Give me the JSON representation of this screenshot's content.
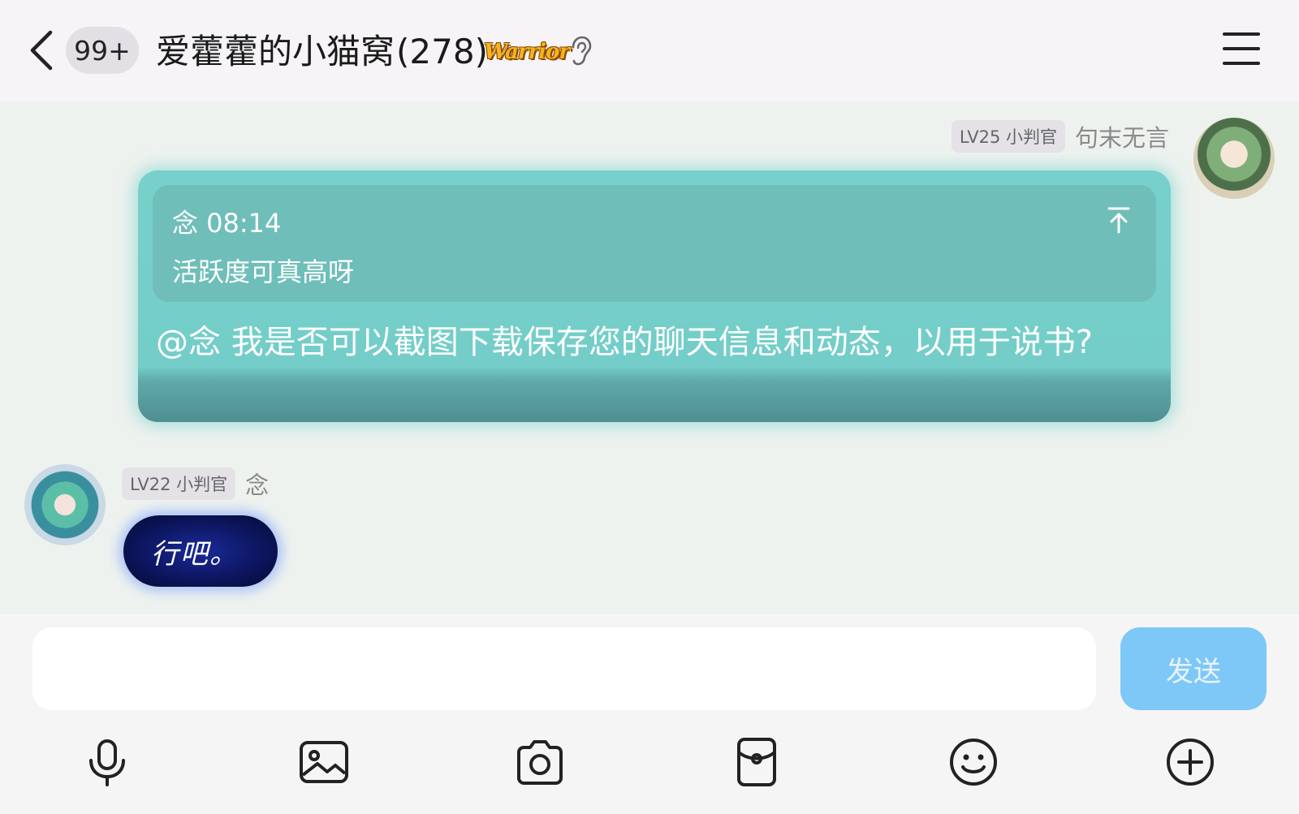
{
  "header": {
    "unread_badge": "99+",
    "group_name": "爱藿藿的小猫窝",
    "member_count": "(278)",
    "title_badge": "Warrior"
  },
  "messages": [
    {
      "side": "right",
      "level": "LV25 小判官",
      "nickname": "句末无言",
      "quote": {
        "author_time": "念 08:14",
        "text": "活跃度可真高呀"
      },
      "text": "@念 我是否可以截图下载保存您的聊天信息和动态，以用于说书?"
    },
    {
      "side": "left",
      "level": "LV22 小判官",
      "nickname": "念",
      "text": "行吧。"
    }
  ],
  "input": {
    "value": "",
    "send_label": "发送"
  },
  "toolbar": [
    "microphone-icon",
    "image-icon",
    "camera-icon",
    "red-packet-icon",
    "emoji-icon",
    "plus-icon"
  ],
  "colors": {
    "header_bg": "#f7f4f8",
    "chat_bg": "#eef2ef",
    "bubble_teal": "#77d0cb",
    "bubble_dark_blue": "#0d1660",
    "send_button": "#7ec8f8"
  }
}
